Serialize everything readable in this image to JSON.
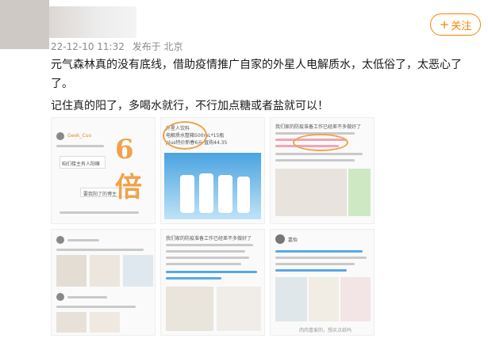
{
  "post": {
    "timestamp": "22-12-10 11:32",
    "source": "发布于 北京",
    "follow_label": "关注",
    "follow_icon": "plus-icon",
    "paragraphs": [
      "元气森林真的没有底线，借助疫情推广自家的外星人电解质水，太低俗了，太恶心了了。",
      "记住真的阳了，多喝水就行，不行加点糖或者盐就可以！"
    ]
  },
  "tiles": {
    "t1": {
      "user": "Geek_Cuo",
      "bubble1": "咱们楼主有人阳嘛",
      "bubble2": "要我阳了的博主",
      "hand": "6倍"
    },
    "t2": {
      "brand": "外星人饮料",
      "title": "电解质水整箱500mL*15瓶",
      "price": "plus特价新春6元 直购44.35"
    },
    "t3": {
      "lead": "我们家的防疫准备工作已经差不多做好了"
    },
    "t5": {
      "lead": "我们家的防疫准备工作已经差不多做好了"
    },
    "t6": {
      "user": "嘉怡",
      "footer": "肉肉喜爱的，想买点纸吗"
    }
  },
  "colors": {
    "accent": "#ff8200",
    "meta": "#8a8a8a",
    "annotation": "#f0a24b"
  }
}
